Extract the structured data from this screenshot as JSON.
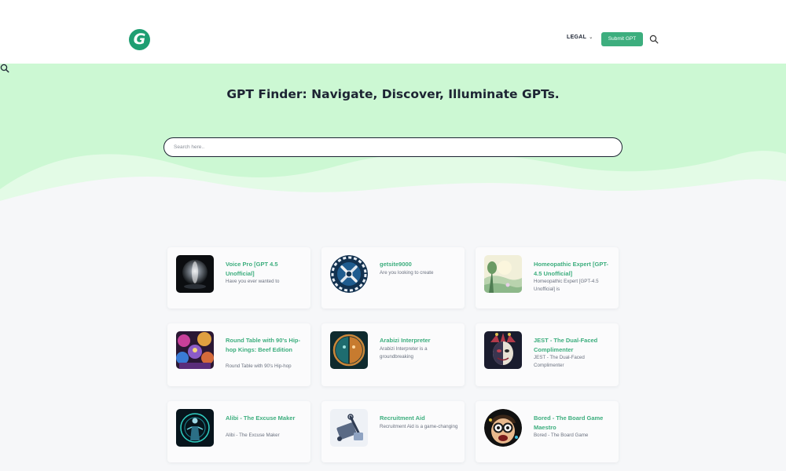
{
  "header": {
    "logo_letter": "G",
    "legal_label": "LEGAL",
    "submit_label": "Submit GPT",
    "search_icon": "search-icon"
  },
  "hero": {
    "title": "GPT Finder: Navigate, Discover, Illuminate GPTs.",
    "search_placeholder": "Search here..",
    "colors": {
      "mint": "#ccf8d3",
      "wave": "#e3fbe6",
      "accent": "#3dae7e"
    }
  },
  "cards": [
    {
      "title": "Voice Pro [GPT 4.5 Unofficial]",
      "desc": "Have you ever wanted to",
      "image": "abstract-dark-sphere"
    },
    {
      "title": "getsite9000",
      "desc": "Are you looking to create",
      "image": "gear-wrench-badge"
    },
    {
      "title": "Homeopathic Expert [GPT-4.5 Unofficial]",
      "desc": "Homeopathic Expert [GPT-4.5 Unofficial] is",
      "image": "pastel-landscape"
    },
    {
      "title": "Round Table with 90's Hip-hop Kings: Beef Edition",
      "desc": "Round Table with 90's Hip-hop",
      "image": "neon-crowd"
    },
    {
      "title": "Arabizi Interpreter",
      "desc": "Arabizi Interpreter is a groundbreaking",
      "image": "split-face-circle"
    },
    {
      "title": "JEST - The Dual-Faced Complimenter",
      "desc": "JEST - The Dual-Faced Complimenter",
      "image": "jester-mask"
    },
    {
      "title": "Alibi - The Excuse Maker",
      "desc": "Alibi - The Excuse Maker",
      "image": "neon-figure-ring"
    },
    {
      "title": "Recruitment Aid",
      "desc": "Recruitment Aid is a game-changing",
      "image": "tools-sketch"
    },
    {
      "title": "Bored - The Board Game Maestro",
      "desc": "Bored - The Board Game",
      "image": "cartoon-face-glasses"
    }
  ]
}
